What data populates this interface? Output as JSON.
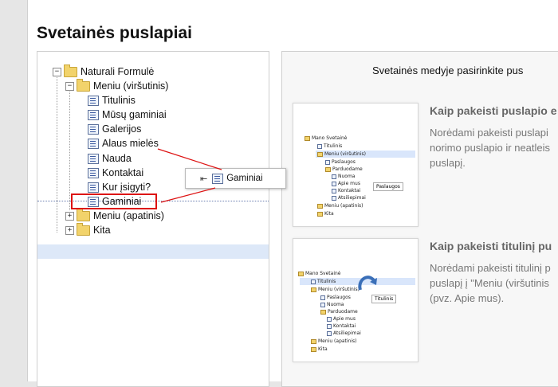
{
  "page": {
    "title": "Svetainės puslapiai"
  },
  "tree": {
    "root": "Naturali Formulė",
    "top_menu": "Meniu (viršutinis)",
    "top_items": [
      "Titulinis",
      "Mūsų gaminiai",
      "Galerijos",
      "Alaus mielės",
      "Nauda",
      "Kontaktai",
      "Kur įsigyti?",
      "Gaminiai"
    ],
    "bottom_menu": "Meniu (apatinis)",
    "other": "Kita",
    "toggle_expanded": "−",
    "toggle_collapsed": "+",
    "selected_item": "Gaminiai"
  },
  "drag_ghost": {
    "label": "Gaminiai",
    "icon": "drop-insert-icon"
  },
  "help": {
    "intro": "Svetainės medyje pasirinkite pus",
    "tips": [
      {
        "title": "Kaip pakeisti puslapio e",
        "body": "Norėdami pakeisti puslapi norimo puslapio ir neatleis puslapį.",
        "illustration": {
          "items": [
            "Mano Svetainė",
            "Titulinis",
            "Meniu (viršutinis)",
            "Paslaugos",
            "Parduodame",
            "Nuoma",
            "Apie mus",
            "Kontaktai",
            "Atsiliepimai",
            "Meniu (apatinis)",
            "Kita"
          ],
          "ghost": "Paslaugos"
        }
      },
      {
        "title": "Kaip pakeisti titulinį pu",
        "body": "Norėdami pakeisti titulinį p puslapį į \"Meniu (viršutinis (pvz. Apie mus).",
        "illustration": {
          "items": [
            "Mano Svetainė",
            "Titulinis",
            "Meniu (viršutinis)",
            "Paslaugos",
            "Nuoma",
            "Parduodame",
            "Apie mus",
            "Kontaktai",
            "Atsiliepimai",
            "Meniu (apatinis)",
            "Kita"
          ],
          "ghost": "Titulinis"
        }
      }
    ]
  },
  "colors": {
    "highlight_border": "#dd1111",
    "selection": "#dde8f8",
    "folder": "#f2d36b"
  }
}
